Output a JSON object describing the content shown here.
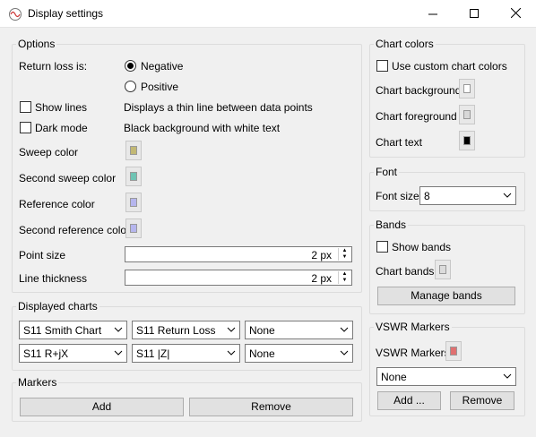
{
  "window": {
    "title": "Display settings",
    "controls": {
      "minimize": "minimize",
      "maximize": "maximize",
      "close": "close"
    }
  },
  "options": {
    "title": "Options",
    "return_loss_label": "Return loss is:",
    "negative_label": "Negative",
    "positive_label": "Positive",
    "negative_selected": true,
    "show_lines_label": "Show lines",
    "show_lines_desc": "Displays a thin line between data points",
    "show_lines_checked": false,
    "dark_mode_label": "Dark mode",
    "dark_mode_desc": "Black background with white text",
    "dark_mode_checked": false,
    "sweep_color_label": "Sweep color",
    "sweep_color": "#c2b874",
    "second_sweep_color_label": "Second sweep color",
    "second_sweep_color": "#6fc4b4",
    "reference_color_label": "Reference color",
    "reference_color": "#b6b6ee",
    "second_reference_color_label": "Second reference color",
    "second_reference_color": "#b6b6ee",
    "point_size_label": "Point size",
    "point_size_value": "2 px",
    "line_thickness_label": "Line thickness",
    "line_thickness_value": "2 px"
  },
  "displayed_charts": {
    "title": "Displayed charts",
    "row1": [
      "S11 Smith Chart",
      "S11 Return Loss",
      "None"
    ],
    "row2": [
      "S11 R+jX",
      "S11 |Z|",
      "None"
    ]
  },
  "markers": {
    "title": "Markers",
    "add_label": "Add",
    "remove_label": "Remove"
  },
  "chart_colors": {
    "title": "Chart colors",
    "use_custom_label": "Use custom chart colors",
    "use_custom_checked": false,
    "background_label": "Chart background",
    "background_color": "#ffffff",
    "foreground_label": "Chart foreground",
    "foreground_color": "#d8d8d8",
    "text_label": "Chart text",
    "text_color": "#000000"
  },
  "font": {
    "title": "Font",
    "size_label": "Font size",
    "size_value": "8"
  },
  "bands": {
    "title": "Bands",
    "show_bands_label": "Show bands",
    "show_bands_checked": false,
    "chart_bands_label": "Chart bands",
    "chart_bands_color": "#dcdcdc",
    "manage_label": "Manage bands"
  },
  "vswr": {
    "title": "VSWR Markers",
    "markers_label": "VSWR Markers",
    "markers_color": "#e07070",
    "select_value": "None",
    "add_label": "Add ...",
    "remove_label": "Remove"
  }
}
